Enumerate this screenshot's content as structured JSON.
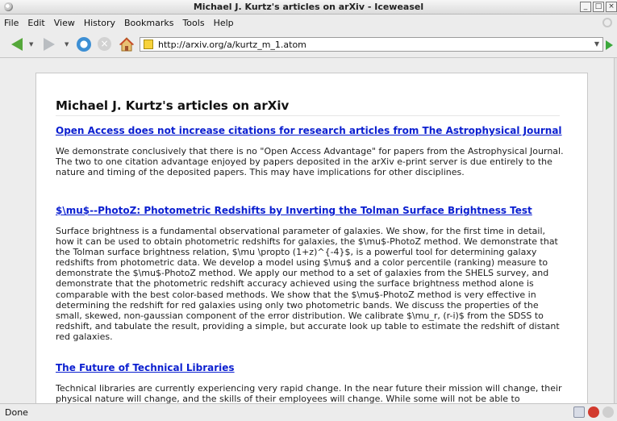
{
  "window": {
    "title": "Michael J. Kurtz's articles on arXiv - Iceweasel",
    "controls": [
      "_",
      "□",
      "×"
    ]
  },
  "menu": [
    "File",
    "Edit",
    "View",
    "History",
    "Bookmarks",
    "Tools",
    "Help"
  ],
  "toolbar": {
    "url": "http://arxiv.org/a/kurtz_m_1.atom"
  },
  "page": {
    "title": "Michael J. Kurtz's articles on arXiv",
    "articles": [
      {
        "title": "Open Access does not increase citations for research articles from The Astrophysical Journal",
        "abstract": "We demonstrate conclusively that there is no \"Open Access Advantage\" for papers from the Astrophysical Journal. The two to one citation advantage enjoyed by papers deposited in the arXiv e-print server is due entirely to the nature and timing of the deposited papers. This may have implications for other disciplines."
      },
      {
        "title": "$\\mu$--PhotoZ: Photometric Redshifts by Inverting the Tolman Surface Brightness Test",
        "abstract": "Surface brightness is a fundamental observational parameter of galaxies. We show, for the first time in detail, how it can be used to obtain photometric redshifts for galaxies, the $\\mu$-PhotoZ method. We demonstrate that the Tolman surface brightness relation, $\\mu \\propto (1+z)^{-4}$, is a powerful tool for determining galaxy redshifts from photometric data. We develop a model using $\\mu$ and a color percentile (ranking) measure to demonstrate the $\\mu$-PhotoZ method. We apply our method to a set of galaxies from the SHELS survey, and demonstrate that the photometric redshift accuracy achieved using the surface brightness method alone is comparable with the best color-based methods. We show that the $\\mu$-PhotoZ method is very effective in determining the redshift for red galaxies using only two photometric bands. We discuss the properties of the small, skewed, non-gaussian component of the error distribution. We calibrate $\\mu_r, (r-i)$ from the SDSS to redshift, and tabulate the result, providing a simple, but accurate look up table to estimate the redshift of distant red galaxies."
      },
      {
        "title": "The Future of Technical Libraries",
        "abstract": "Technical libraries are currently experiencing very rapid change. In the near future their mission will change, their physical nature will change, and the skills of their employees will change. While some will not be able to"
      }
    ]
  },
  "status": {
    "text": "Done"
  }
}
